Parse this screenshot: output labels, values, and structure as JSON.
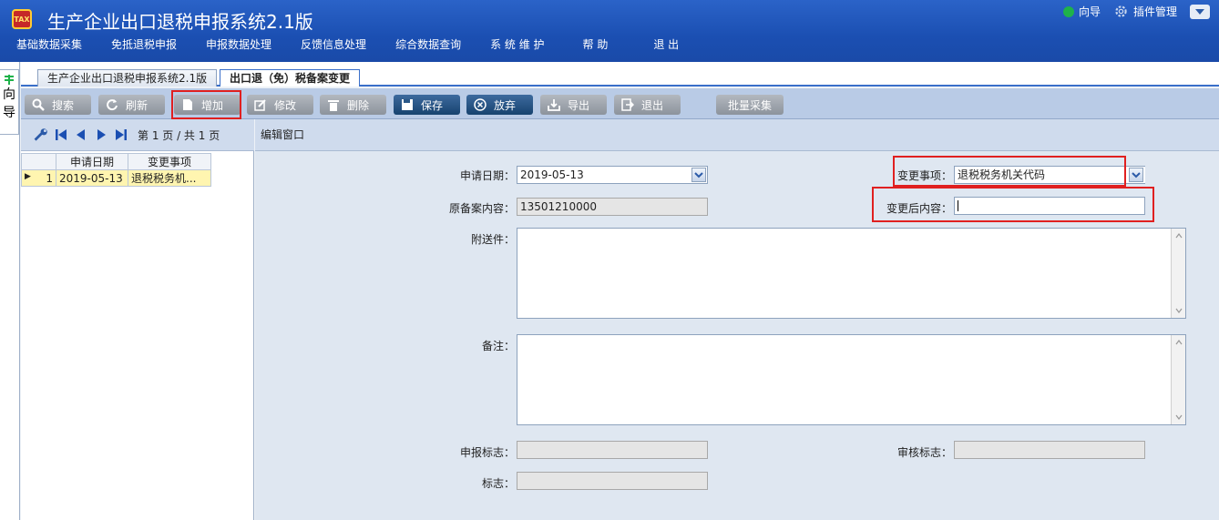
{
  "app": {
    "title": "生产企业出口退税申报系统2.1版",
    "logo_text": "TAX"
  },
  "menu": [
    "基础数据采集",
    "免抵退税申报",
    "申报数据处理",
    "反馈信息处理",
    "综合数据查询",
    "系 统 维 护",
    "帮  助",
    "退  出"
  ],
  "top_right": {
    "guide": "向导",
    "plugins": "插件管理"
  },
  "guide_bar": {
    "chars": [
      "向",
      "导"
    ]
  },
  "tabs": [
    "生产企业出口退税申报系统2.1版",
    "出口退（免）税备案变更"
  ],
  "toolbar": {
    "search": "搜索",
    "refresh": "刷新",
    "add": "增加",
    "edit": "修改",
    "delete": "删除",
    "save": "保存",
    "discard": "放弃",
    "export": "导出",
    "exit": "退出",
    "batch": "批量采集"
  },
  "pager": {
    "text": "第 1 页 / 共 1 页"
  },
  "grid": {
    "headers": [
      "申请日期",
      "变更事项"
    ],
    "rows": [
      {
        "num": "1",
        "date": "2019-05-13",
        "item": "退税税务机..."
      }
    ]
  },
  "edit": {
    "window_title": "编辑窗口",
    "apply_date_label": "申请日期：",
    "apply_date": "2019-05-13",
    "change_item_label": "变更事项：",
    "change_item": "退税税务机关代码",
    "orig_content_label": "原备案内容：",
    "orig_content": "13501210000",
    "new_content_label": "变更后内容：",
    "new_content": "",
    "attach_label": "附送件：",
    "remark_label": "备注：",
    "decl_flag_label": "申报标志：",
    "decl_flag": "",
    "audit_flag_label": "审核标志：",
    "audit_flag": "",
    "flag_label": "标志：",
    "flag": ""
  },
  "colors": {
    "header_blue": "#1b4fb2",
    "highlight_red": "#e02020",
    "selected_row": "#fff5b0"
  }
}
